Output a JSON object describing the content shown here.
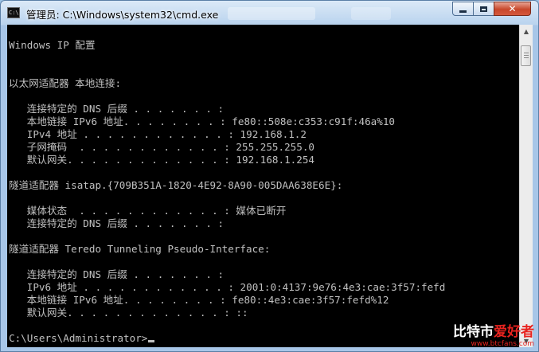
{
  "window": {
    "title": "管理员: C:\\Windows\\system32\\cmd.exe",
    "icon_text": "C:\\",
    "controls": {
      "minimize": "minimize",
      "maximize": "maximize",
      "close": "✕"
    }
  },
  "console": {
    "lines": [
      "",
      "Windows IP 配置",
      "",
      "",
      "以太网适配器 本地连接:",
      "",
      "   连接特定的 DNS 后缀 . . . . . . . :",
      "   本地链接 IPv6 地址. . . . . . . . : fe80::508e:c353:c91f:46a%10",
      "   IPv4 地址 . . . . . . . . . . . . : 192.168.1.2",
      "   子网掩码  . . . . . . . . . . . . : 255.255.255.0",
      "   默认网关. . . . . . . . . . . . . : 192.168.1.254",
      "",
      "隧道适配器 isatap.{709B351A-1820-4E92-8A90-005DAA638E6E}:",
      "",
      "   媒体状态  . . . . . . . . . . . . : 媒体已断开",
      "   连接特定的 DNS 后缀 . . . . . . . :",
      "",
      "隧道适配器 Teredo Tunneling Pseudo-Interface:",
      "",
      "   连接特定的 DNS 后缀 . . . . . . . :",
      "   IPv6 地址 . . . . . . . . . . . . : 2001:0:4137:9e76:4e3:cae:3f57:fefd",
      "   本地链接 IPv6 地址. . . . . . . . : fe80::4e3:cae:3f57:fefd%12",
      "   默认网关. . . . . . . . . . . . . : ::",
      "",
      "C:\\Users\\Administrator>"
    ]
  },
  "scrollbar": {
    "up_glyph": "▲",
    "down_glyph": "▼",
    "position_fraction": 0.04
  },
  "watermark": {
    "part1": "比特市",
    "part2": "爱好者",
    "url": "www.btcfans.com"
  },
  "colors": {
    "console_bg": "#000000",
    "console_text": "#c0c0c0",
    "watermark_red": "#e8231f"
  }
}
